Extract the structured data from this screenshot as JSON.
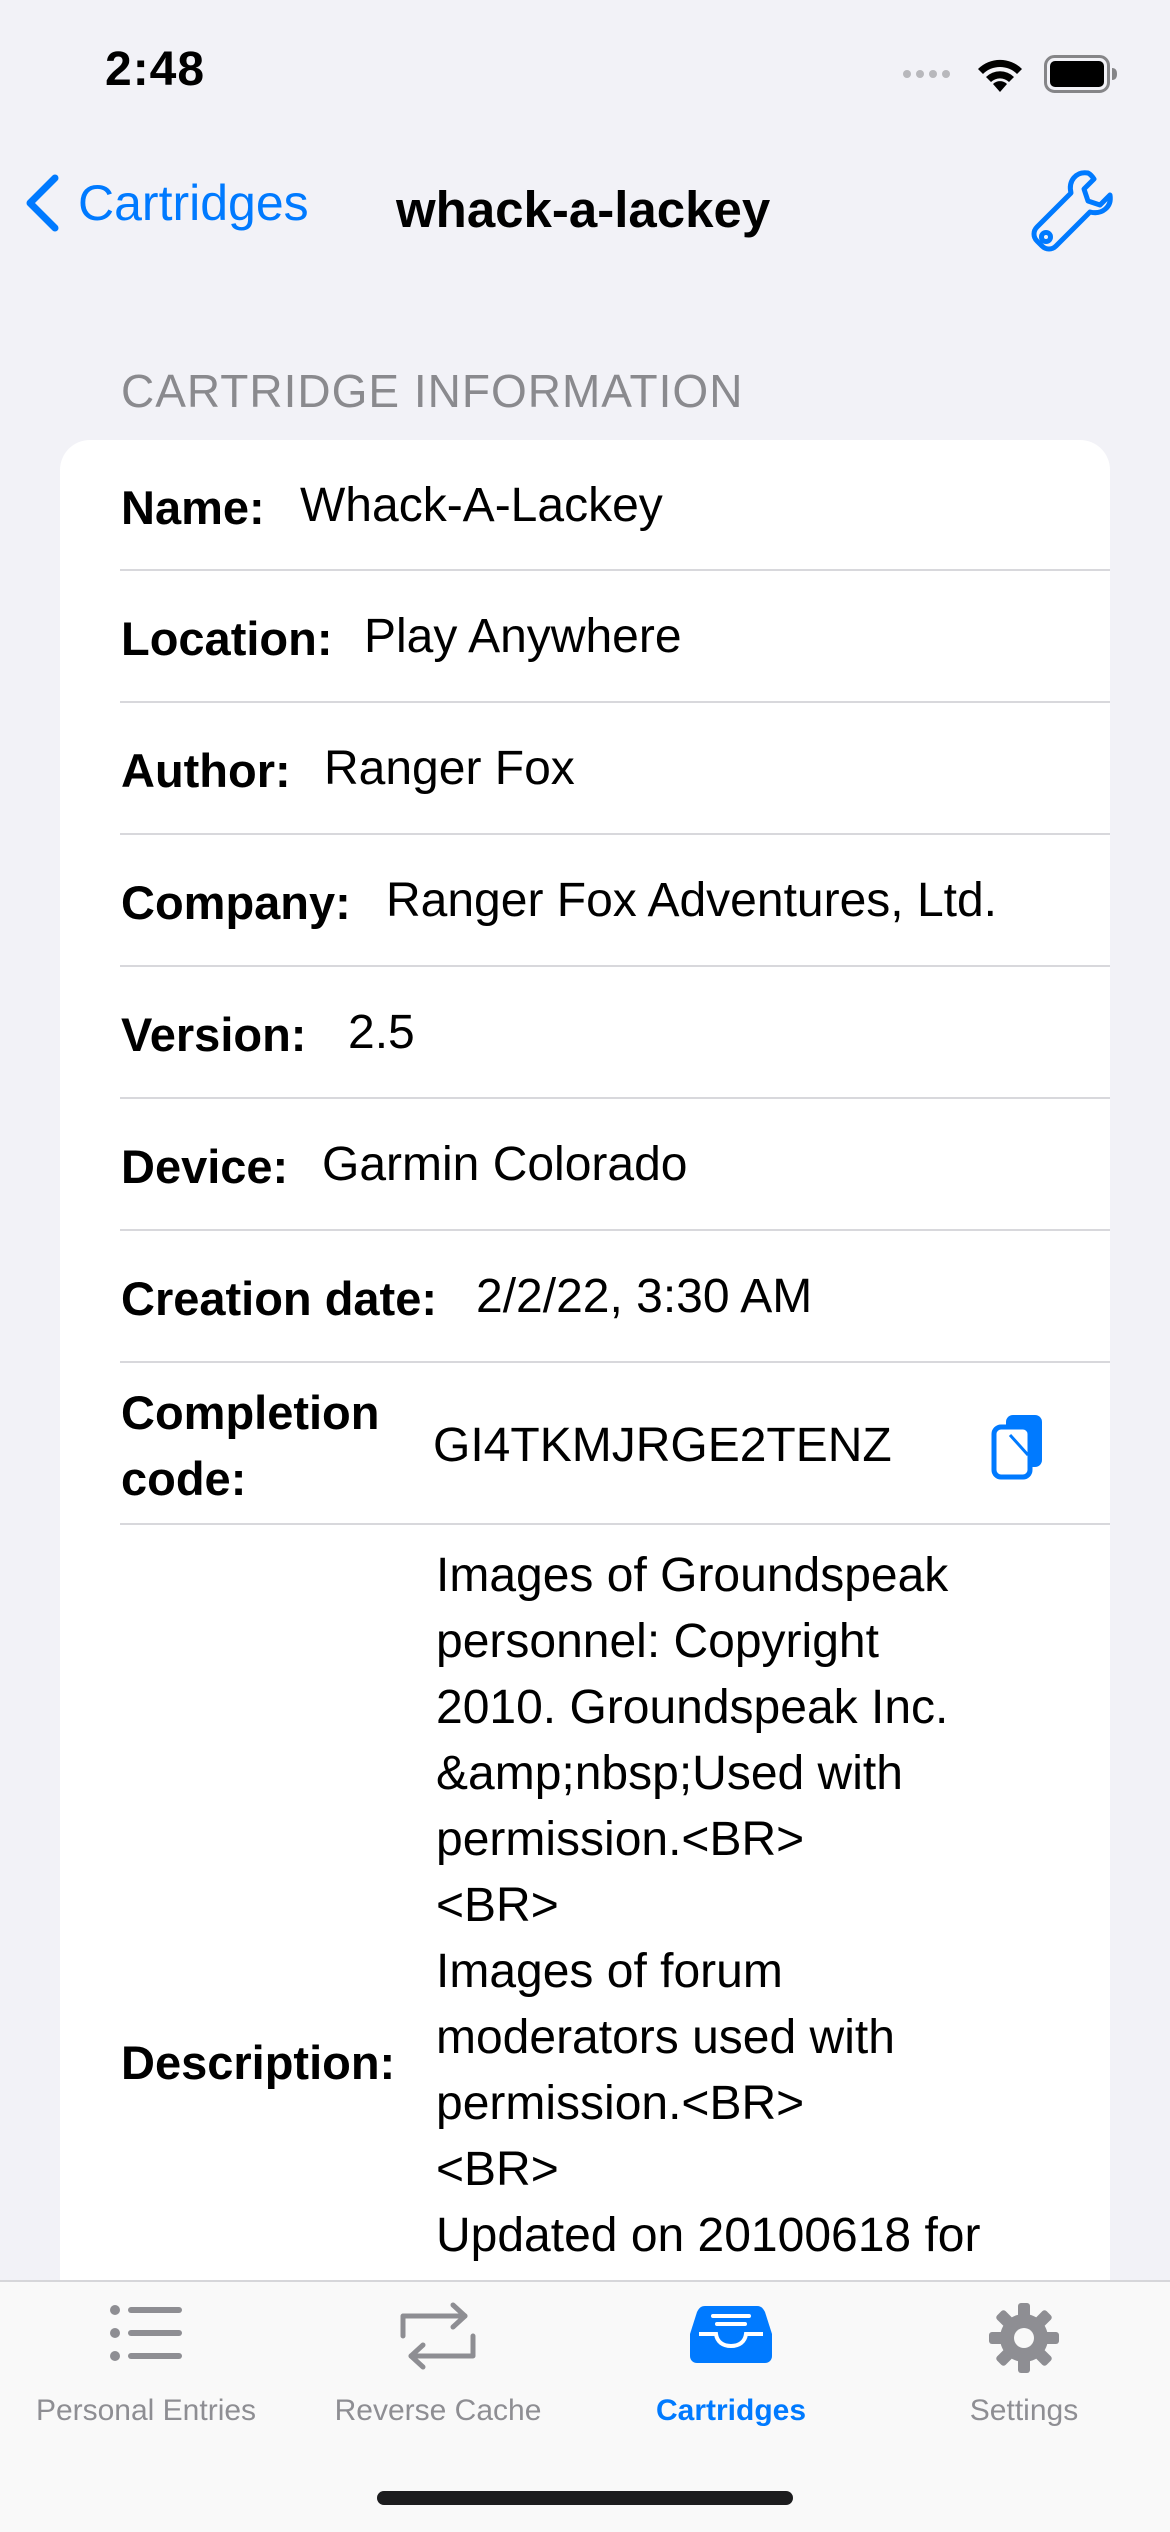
{
  "status": {
    "time": "2:48"
  },
  "nav": {
    "back_label": "Cartridges",
    "title": "whack-a-lackey"
  },
  "section": {
    "header": "CARTRIDGE INFORMATION"
  },
  "info": {
    "name_label": "Name:",
    "name_value": "Whack-A-Lackey",
    "location_label": "Location:",
    "location_value": "Play Anywhere",
    "author_label": "Author:",
    "author_value": "Ranger Fox",
    "company_label": "Company:",
    "company_value": "Ranger Fox Adventures, Ltd.",
    "version_label": "Version:",
    "version_value": "2.5",
    "device_label": "Device:",
    "device_value": "Garmin Colorado",
    "creation_label": "Creation date:",
    "creation_value": "2/2/22, 3:30 AM",
    "completion_label_line1": "Completion",
    "completion_label_line2": "code:",
    "completion_value": "GI4TKMJRGE2TENZ",
    "description_label": "Description:",
    "description_lines": [
      "Images of Groundspeak",
      "personnel: Copyright",
      "2010. Groundspeak Inc.",
      "&amp;nbsp;Used with",
      "permission.<BR>",
      "<BR>",
      "Images of forum",
      "moderators used with",
      "permission.<BR>",
      "<BR>",
      "Updated on 20100618 for"
    ]
  },
  "tabs": [
    {
      "label": "Personal Entries",
      "icon": "list-icon"
    },
    {
      "label": "Reverse Cache",
      "icon": "reverse-arrows-icon"
    },
    {
      "label": "Cartridges",
      "icon": "tray-icon"
    },
    {
      "label": "Settings",
      "icon": "gear-icon"
    }
  ],
  "colors": {
    "accent": "#007aff",
    "background": "#f2f2f7",
    "inactive_tab": "#8e8e93"
  }
}
